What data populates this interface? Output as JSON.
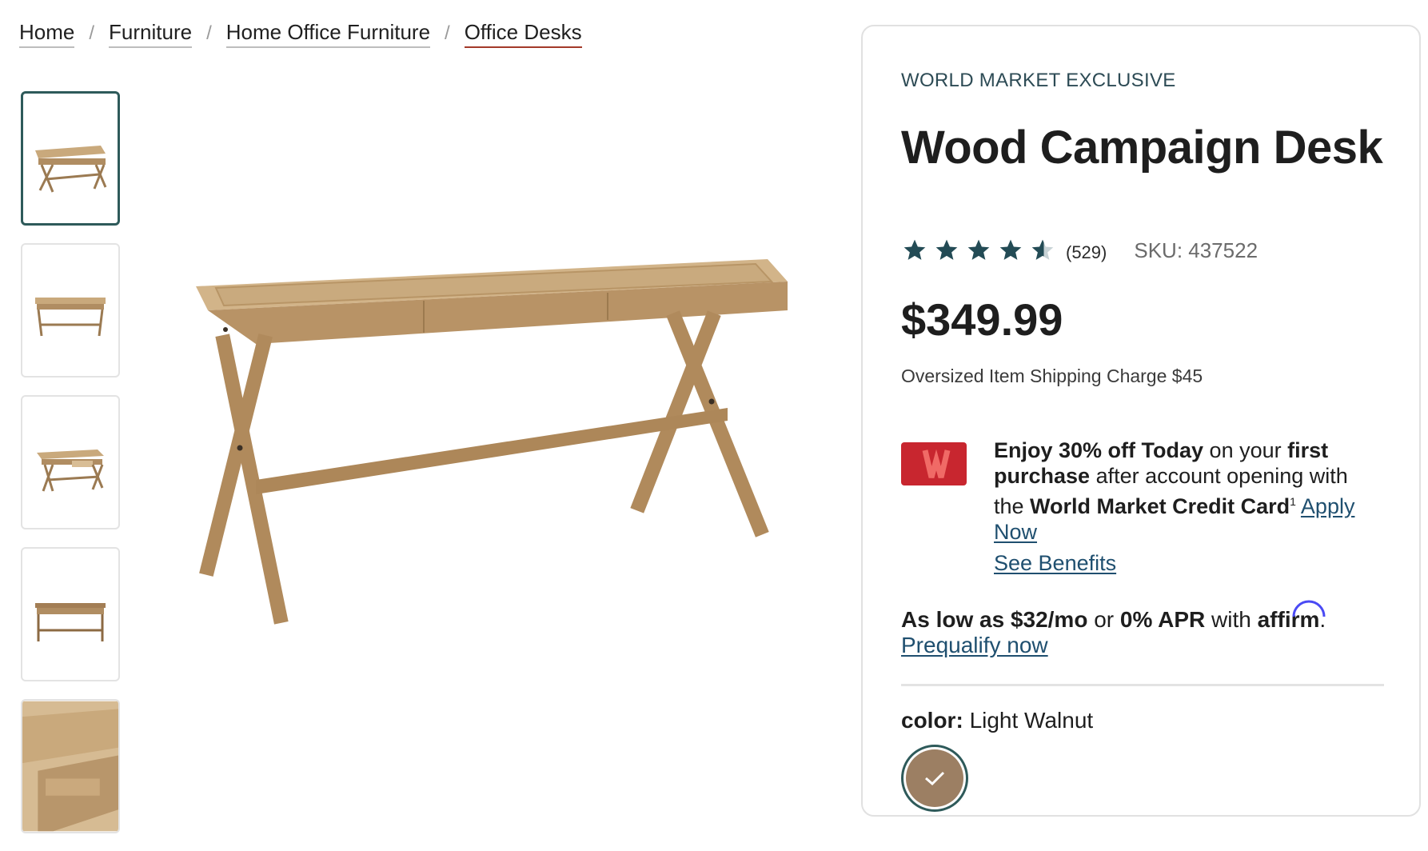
{
  "breadcrumb": {
    "items": [
      {
        "label": "Home"
      },
      {
        "label": "Furniture"
      },
      {
        "label": "Home Office Furniture"
      },
      {
        "label": "Office Desks"
      }
    ],
    "separator": "/"
  },
  "gallery": {
    "thumbnails": [
      {
        "icon": "desk-front-angle-thumbnail"
      },
      {
        "icon": "desk-front-thumbnail"
      },
      {
        "icon": "desk-drawer-open-thumbnail"
      },
      {
        "icon": "desk-front-thumbnail"
      },
      {
        "icon": "desk-detail-thumbnail"
      }
    ],
    "main_image": "wood-campaign-desk-image"
  },
  "product": {
    "eyebrow": "WORLD MARKET EXCLUSIVE",
    "title": "Wood Campaign Desk",
    "rating": 4.5,
    "rating_max": 5,
    "reviews": "(529)",
    "sku": "SKU: 437522",
    "price": "$349.99",
    "shipping": "Oversized Item Shipping Charge $45"
  },
  "promo": {
    "part1_bold": "Enjoy 30% off Today",
    "part2": " on your ",
    "part3_bold": "first purchase",
    "part4": " after account opening with the ",
    "part5_bold": "World Market Credit Card",
    "sup": "1",
    "apply_link": "Apply Now",
    "see_benefits": "See Benefits"
  },
  "financing": {
    "bold1": "As low as $32/mo",
    "text1": " or ",
    "bold2": "0% APR",
    "text2": " with ",
    "brand": "affirm",
    "end": ".",
    "link": "Prequalify now"
  },
  "color": {
    "label": "color:",
    "value": "Light Walnut",
    "swatch_hex": "#9c7f63"
  },
  "colors": {
    "accent": "#2e5a5a",
    "link": "#1f4f6f",
    "card_red": "#c8262f"
  }
}
